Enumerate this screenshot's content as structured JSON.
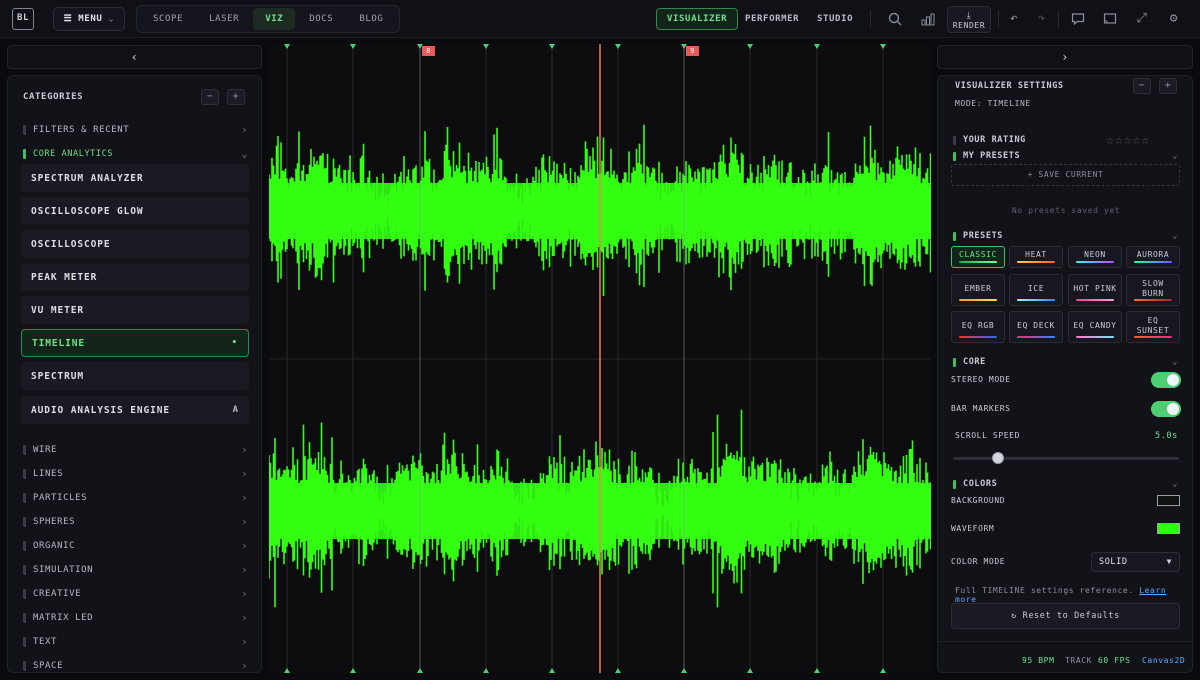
{
  "topbar": {
    "logo": "BL",
    "menu_label": "MENU",
    "nav_tabs": [
      "SCOPE",
      "LASER",
      "VIZ",
      "DOCS",
      "BLOG"
    ],
    "active_nav": "VIZ",
    "mode_tabs": [
      "VISUALIZER",
      "PERFORMER",
      "STUDIO"
    ],
    "active_mode": "VISUALIZER",
    "render_label": "RENDER",
    "icons": [
      "search-icon",
      "bar-chart-icon",
      "download-icon",
      "undo-icon",
      "redo-icon",
      "chat-icon",
      "cast-icon",
      "fullscreen-icon",
      "gear-icon"
    ]
  },
  "sidebar": {
    "header": "CATEGORIES",
    "top_categories": [
      {
        "label": "FILTERS & RECENT"
      },
      {
        "label": "CORE ANALYTICS"
      }
    ],
    "items": [
      {
        "label": "SPECTRUM ANALYZER",
        "tag": ""
      },
      {
        "label": "OSCILLOSCOPE GLOW",
        "tag": ""
      },
      {
        "label": "OSCILLOSCOPE",
        "tag": ""
      },
      {
        "label": "PEAK METER",
        "tag": ""
      },
      {
        "label": "VU METER",
        "tag": ""
      },
      {
        "label": "TIMELINE",
        "tag": "•"
      },
      {
        "label": "SPECTRUM",
        "tag": ""
      },
      {
        "label": "AUDIO ANALYSIS ENGINE",
        "tag": "A"
      }
    ],
    "active_item": "TIMELINE",
    "categories": [
      "WIRE",
      "LINES",
      "PARTICLES",
      "SPHERES",
      "ORGANIC",
      "SIMULATION",
      "CREATIVE",
      "MATRIX LED",
      "TEXT",
      "SPACE"
    ]
  },
  "timeline": {
    "bar_markers": [
      "8",
      "9"
    ],
    "waveform_color": "#33ff11",
    "playhead_color": "#f07a5a",
    "marker_color": "#4fcf74"
  },
  "settings": {
    "title": "VISUALIZER SETTINGS",
    "mode_line": "MODE: TIMELINE",
    "rating_label": "YOUR RATING",
    "stars": "☆☆☆☆☆",
    "my_presets_label": "MY PRESETS",
    "save_current": "+ SAVE CURRENT",
    "no_presets": "No presets saved yet",
    "presets_label": "PRESETS",
    "presets": [
      {
        "label": "CLASSIC",
        "colors": [
          "#1fa84a",
          "#7dff9a"
        ]
      },
      {
        "label": "HEAT",
        "colors": [
          "#ffd24a",
          "#ff5a2a"
        ]
      },
      {
        "label": "NEON",
        "colors": [
          "#3ff0ff",
          "#c04aff"
        ]
      },
      {
        "label": "AURORA",
        "colors": [
          "#2aff9a",
          "#6a5aff"
        ]
      },
      {
        "label": "EMBER",
        "colors": [
          "#ff9a2a",
          "#ffe04a"
        ]
      },
      {
        "label": "ICE",
        "colors": [
          "#9af0ff",
          "#2a8aff"
        ]
      },
      {
        "label": "HOT PINK",
        "colors": [
          "#ff3aa0",
          "#ff9ad4"
        ]
      },
      {
        "label": "SLOW BURN",
        "colors": [
          "#ff6a2a",
          "#a02a2a"
        ]
      },
      {
        "label": "EQ RGB",
        "colors": [
          "#ff2a2a",
          "#2a6aff"
        ]
      },
      {
        "label": "EQ DECK",
        "colors": [
          "#ff2a6a",
          "#2a8aff"
        ]
      },
      {
        "label": "EQ CANDY",
        "colors": [
          "#ff7ad0",
          "#7ae0ff"
        ]
      },
      {
        "label": "EQ SUNSET",
        "colors": [
          "#ff5a2a",
          "#ff2a8a"
        ]
      }
    ],
    "active_preset": "CLASSIC",
    "core_label": "CORE",
    "stereo_label": "STEREO MODE",
    "stereo_on": true,
    "bar_markers_label": "BAR MARKERS",
    "bar_markers_on": true,
    "scroll_label": "SCROLL SPEED",
    "scroll_value": "5.0s",
    "scroll_fraction": 0.2,
    "colors_label": "COLORS",
    "background_label": "BACKGROUND",
    "background_color": "#111111",
    "waveform_label": "WAVEFORM",
    "waveform_color": "#33ff11",
    "color_mode_label": "COLOR MODE",
    "color_mode_value": "SOLID",
    "ref_text": "Full TIMELINE settings reference.",
    "learn_more": "Learn more",
    "reset_label": "Reset to Defaults"
  },
  "footer": {
    "bpm": "95 BPM",
    "track": "TRACK",
    "fps": "60 FPS",
    "renderer": "Canvas2D"
  },
  "colors": {
    "accent": "#4fcf74",
    "background": "#0b0b0f",
    "panel": "#121219",
    "link": "#5aa8ff"
  }
}
